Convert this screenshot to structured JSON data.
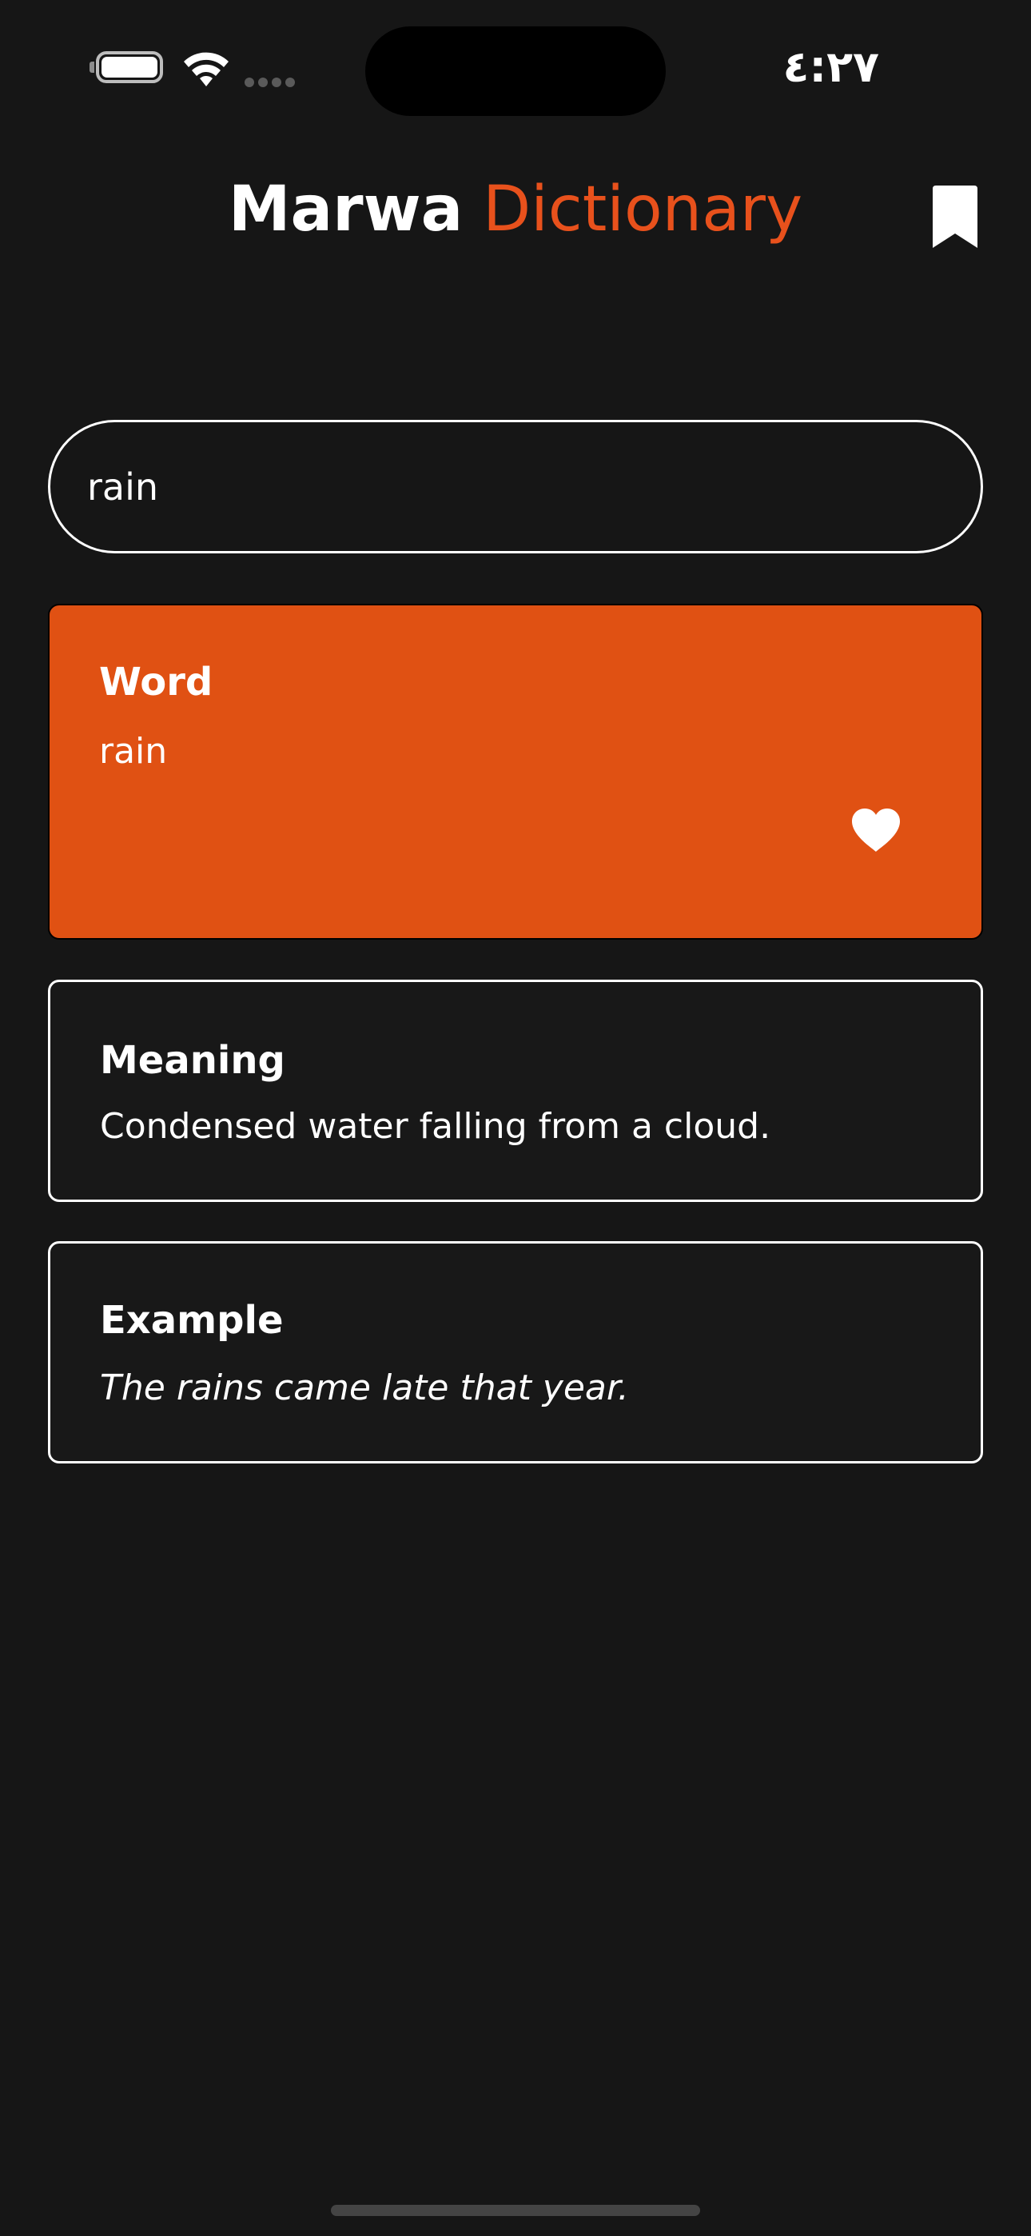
{
  "status_bar": {
    "time": "٤:٢٧"
  },
  "header": {
    "title_part1": "Marwa",
    "title_part2": "Dictionary",
    "accent_color": "#e8511c"
  },
  "search": {
    "value": "rain"
  },
  "word_card": {
    "heading": "Word",
    "value": "rain",
    "background_color": "#e05113",
    "favorite_icon": "heart-icon"
  },
  "meaning_card": {
    "heading": "Meaning",
    "text": "Condensed water falling from a cloud."
  },
  "example_card": {
    "heading": "Example",
    "text": "The rains came late that year."
  },
  "icons": {
    "battery": "battery-icon",
    "wifi": "wifi-icon",
    "signal": "signal-icon",
    "bookmark": "bookmark-icon"
  }
}
